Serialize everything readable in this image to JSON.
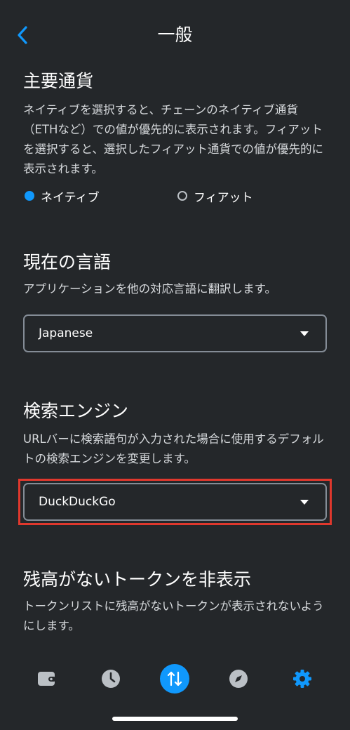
{
  "header": {
    "title": "一般",
    "back_icon": "chevron-left-icon"
  },
  "primary_currency": {
    "title": "主要通貨",
    "description": "ネイティブを選択すると、チェーンのネイティブ通貨（ETHなど）での値が優先的に表示されます。フィアットを選択すると、選択したフィアット通貨での値が優先的に表示されます。",
    "options": [
      {
        "label": "ネイティブ",
        "selected": true
      },
      {
        "label": "フィアット",
        "selected": false
      }
    ]
  },
  "language": {
    "title": "現在の言語",
    "description": "アプリケーションを他の対応言語に翻訳します。",
    "selected_value": "Japanese"
  },
  "search_engine": {
    "title": "検索エンジン",
    "description": "URLバーに検索語句が入力された場合に使用するデフォルトの検索エンジンを変更します。",
    "selected_value": "DuckDuckGo"
  },
  "hide_zero_balance": {
    "title": "残高がないトークンを非表示",
    "description": "トークンリストに残高がないトークンが表示されないようにします。"
  },
  "tabbar": {
    "tabs": [
      {
        "icon": "wallet-icon",
        "active": false
      },
      {
        "icon": "clock-icon",
        "active": false
      },
      {
        "icon": "swap-arrows-icon",
        "active": false
      },
      {
        "icon": "compass-icon",
        "active": false
      },
      {
        "icon": "gear-icon",
        "active": true
      }
    ]
  },
  "colors": {
    "background": "#24272a",
    "accent": "#1098fc",
    "highlight": "#e0382d",
    "muted_icon": "#bbc0c5"
  }
}
